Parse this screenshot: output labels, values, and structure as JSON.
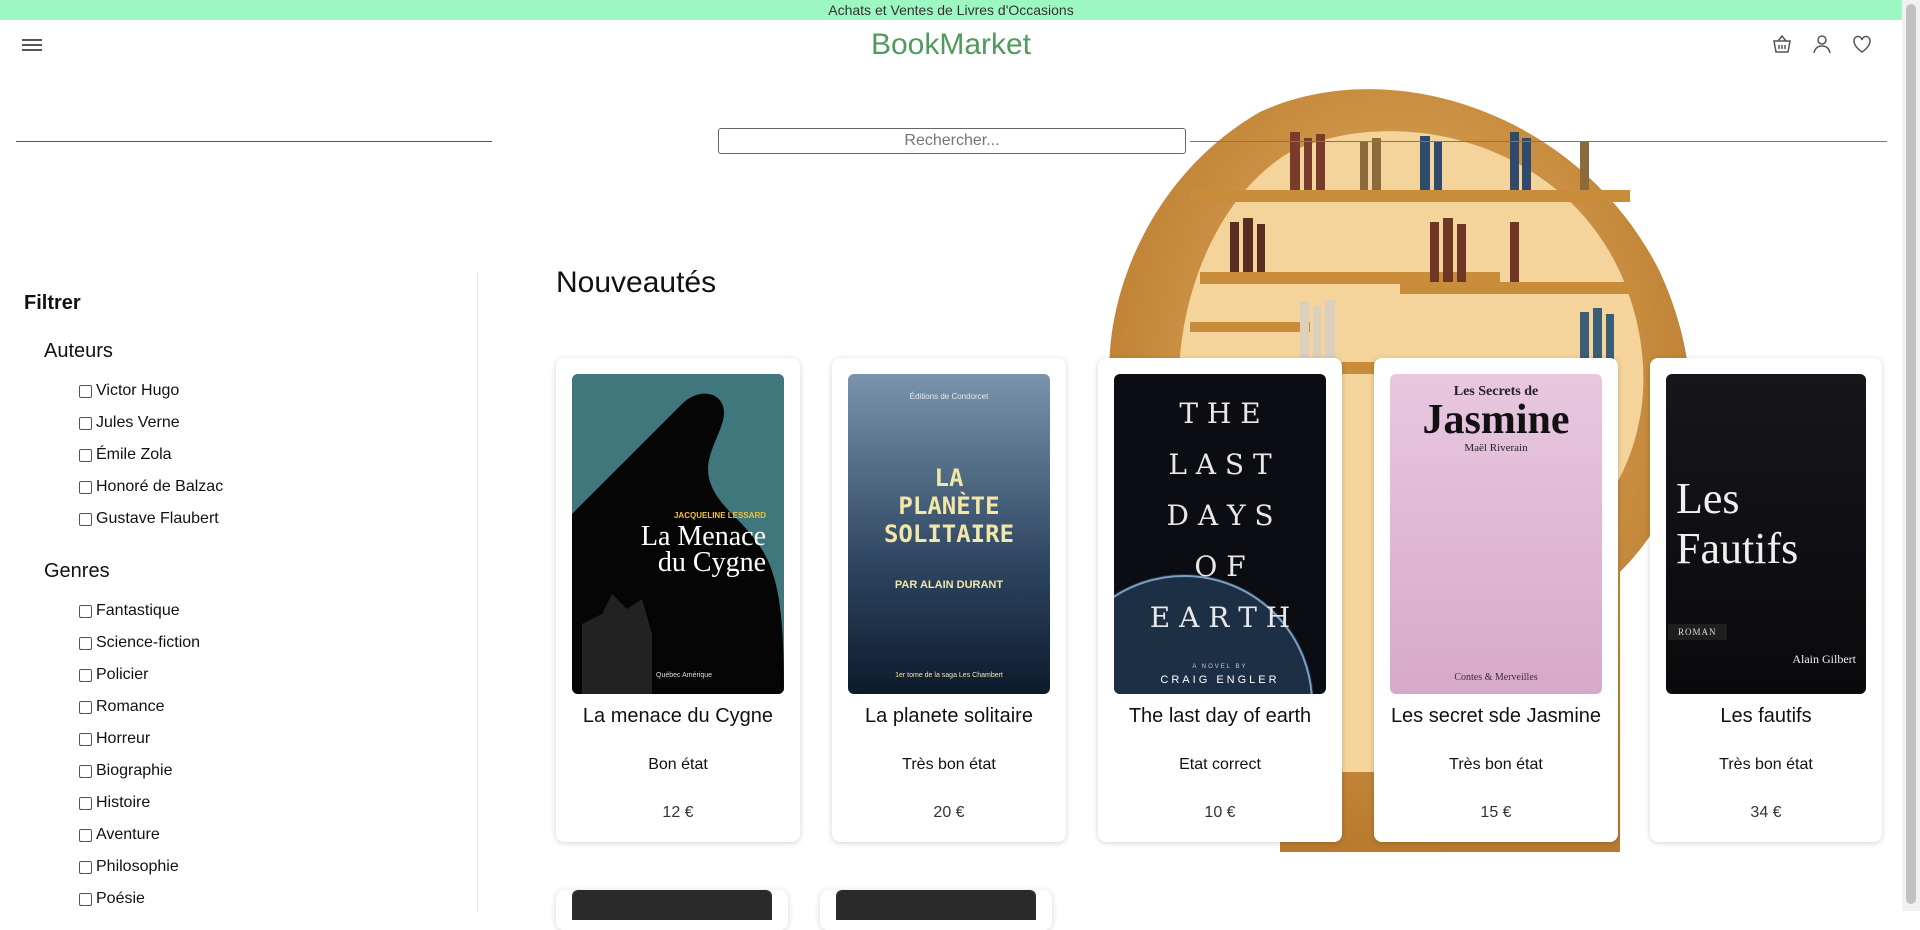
{
  "topbar": {
    "text": "Achats et Ventes de Livres d'Occasions"
  },
  "header": {
    "brand": "BookMarket"
  },
  "search": {
    "placeholder": "Rechercher..."
  },
  "sidebar": {
    "title": "Filtrer",
    "authors_title": "Auteurs",
    "authors": [
      "Victor Hugo",
      "Jules Verne",
      "Émile Zola",
      "Honoré de Balzac",
      "Gustave Flaubert"
    ],
    "genres_title": "Genres",
    "genres": [
      "Fantastique",
      "Science-fiction",
      "Policier",
      "Romance",
      "Horreur",
      "Biographie",
      "Histoire",
      "Aventure",
      "Philosophie",
      "Poésie"
    ]
  },
  "main": {
    "section_title": "Nouveautés",
    "books": [
      {
        "title": "La menace du Cygne",
        "condition": "Bon état",
        "price": "12 €",
        "cover": {
          "author": "JACQUELINE LESSARD",
          "title_lines": [
            "La Menace",
            "du Cygne"
          ],
          "footer": "Québec Amérique"
        }
      },
      {
        "title": "La planete solitaire",
        "condition": "Très bon état",
        "price": "20 €",
        "cover": {
          "top": "Éditions de Condorcet",
          "title_lines": [
            "LA",
            "PLANÈTE",
            "SOLITAIRE"
          ],
          "byline": "PAR ALAIN DURANT",
          "footer": "1er tome de la saga Les Chambert"
        }
      },
      {
        "title": "The last day of earth",
        "condition": "Etat correct",
        "price": "10 €",
        "cover": {
          "title_lines": [
            "T H E",
            "L A S T",
            "D A Y S",
            "O F",
            "E A R T H"
          ],
          "byline": "A NOVEL BY",
          "footer": "CRAIG ENGLER"
        }
      },
      {
        "title": "Les secret sde Jasmine",
        "condition": "Très bon état",
        "price": "15 €",
        "cover": {
          "top": "Les Secrets de",
          "title_lines": [
            "Jasmine"
          ],
          "byline": "Maël Riverain",
          "footer": "Contes & Merveilles"
        }
      },
      {
        "title": "Les fautifs",
        "condition": "Très bon état",
        "price": "34 €",
        "cover": {
          "title_lines": [
            "Les",
            "Fautifs"
          ],
          "byline": "ROMAN",
          "footer": "Alain Gilbert"
        }
      }
    ]
  },
  "colors": {
    "topbar": "#9df7c2",
    "brand": "#4f9a5c"
  },
  "icons": [
    "menu-icon",
    "basket-icon",
    "user-icon",
    "heart-icon"
  ]
}
